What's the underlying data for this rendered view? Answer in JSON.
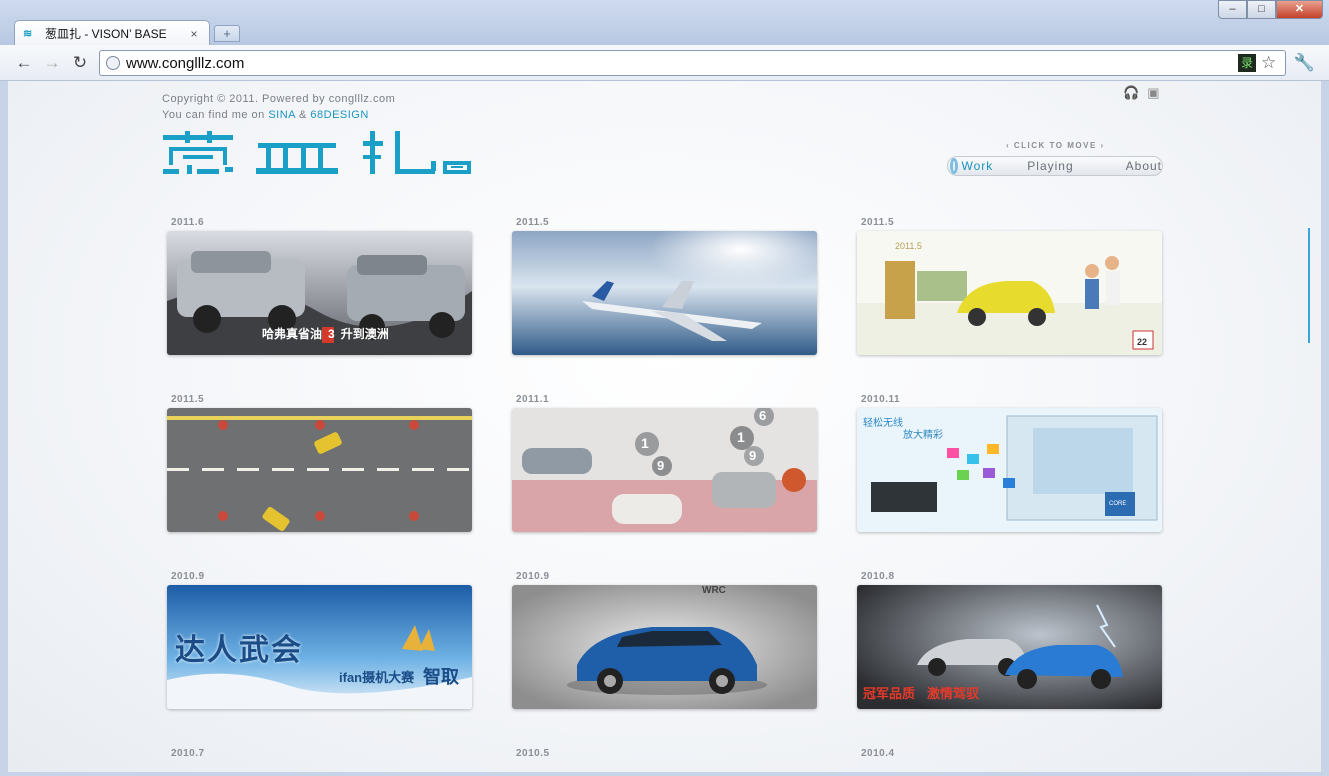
{
  "browser": {
    "tab_title": "葱皿扎 - VISON’  BASE",
    "tab_close": "×",
    "new_tab": "+",
    "url": "www.conglllz.com",
    "window_buttons": [
      "–",
      "□",
      "✕"
    ]
  },
  "header": {
    "copyright": "Copyright © 2011. Powered by conglllz.com",
    "find_prefix": "You can find me on",
    "sina": "SINA",
    "amp": "&",
    "design": "68DESIGN",
    "logo_text": "葱皿扎",
    "click_to_move": "‹ CLICK TO MOVE ›",
    "menu": {
      "work": "Work",
      "playing": "Playing",
      "about": "About"
    }
  },
  "works": [
    {
      "date": "2011.6",
      "caption": "哈弗真省油",
      "caption2": "3",
      "caption3": "升到澳洲"
    },
    {
      "date": "2011.5"
    },
    {
      "date": "2011.5",
      "badge": "22",
      "inner_date": "2011.5"
    },
    {
      "date": "2011.5"
    },
    {
      "date": "2011.1",
      "numbers": [
        "1",
        "9",
        "1",
        "9",
        "6"
      ]
    },
    {
      "date": "2010.11",
      "title1": "轻松无线",
      "title2": "放大精彩",
      "intel": "CORE"
    },
    {
      "date": "2010.9",
      "text": "达人武会",
      "text2": "ifan摄机大赛",
      "text3": "智取"
    },
    {
      "date": "2010.9",
      "tag": "WRC"
    },
    {
      "date": "2010.8",
      "text": "冠军品质",
      "text2": "激情驾驭"
    },
    {
      "date": "2010.7"
    },
    {
      "date": "2010.5"
    },
    {
      "date": "2010.4"
    }
  ],
  "colors": {
    "accent": "#1b93c0",
    "logo": "#1aa0c6"
  }
}
